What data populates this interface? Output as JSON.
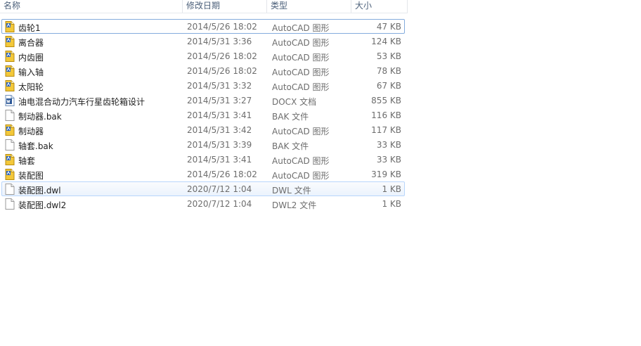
{
  "columns": {
    "name": "名称",
    "date": "修改日期",
    "type": "类型",
    "size": "大小"
  },
  "files": [
    {
      "name": "齿轮1",
      "date": "2014/5/26 18:02",
      "type": "AutoCAD 图形",
      "size": "47 KB",
      "icon": "autocad-drawing-icon"
    },
    {
      "name": "离合器",
      "date": "2014/5/31 3:36",
      "type": "AutoCAD 图形",
      "size": "124 KB",
      "icon": "autocad-drawing-icon"
    },
    {
      "name": "内齿圈",
      "date": "2014/5/26 18:02",
      "type": "AutoCAD 图形",
      "size": "53 KB",
      "icon": "autocad-drawing-icon"
    },
    {
      "name": "输入轴",
      "date": "2014/5/26 18:02",
      "type": "AutoCAD 图形",
      "size": "78 KB",
      "icon": "autocad-drawing-icon"
    },
    {
      "name": "太阳轮",
      "date": "2014/5/31 3:32",
      "type": "AutoCAD 图形",
      "size": "67 KB",
      "icon": "autocad-drawing-icon"
    },
    {
      "name": "油电混合动力汽车行星齿轮箱设计",
      "date": "2014/5/31 3:27",
      "type": "DOCX 文档",
      "size": "855 KB",
      "icon": "word-document-icon"
    },
    {
      "name": "制动器.bak",
      "date": "2014/5/31 3:41",
      "type": "BAK 文件",
      "size": "116 KB",
      "icon": "blank-file-icon"
    },
    {
      "name": "制动器",
      "date": "2014/5/31 3:42",
      "type": "AutoCAD 图形",
      "size": "117 KB",
      "icon": "autocad-drawing-icon"
    },
    {
      "name": "轴套.bak",
      "date": "2014/5/31 3:39",
      "type": "BAK 文件",
      "size": "33 KB",
      "icon": "blank-file-icon"
    },
    {
      "name": "轴套",
      "date": "2014/5/31 3:41",
      "type": "AutoCAD 图形",
      "size": "33 KB",
      "icon": "autocad-drawing-icon"
    },
    {
      "name": "装配图",
      "date": "2014/5/26 18:02",
      "type": "AutoCAD 图形",
      "size": "319 KB",
      "icon": "autocad-drawing-icon"
    },
    {
      "name": "装配图.dwl",
      "date": "2020/7/12 1:04",
      "type": "DWL 文件",
      "size": "1 KB",
      "icon": "blank-file-icon"
    },
    {
      "name": "装配图.dwl2",
      "date": "2020/7/12 1:04",
      "type": "DWL2 文件",
      "size": "1 KB",
      "icon": "blank-file-icon"
    }
  ],
  "colors": {
    "focus_border": "#84acdd",
    "hover_border": "#b8d6fb",
    "header_text": "#4c607a",
    "secondary_text": "#6d6d6d"
  }
}
